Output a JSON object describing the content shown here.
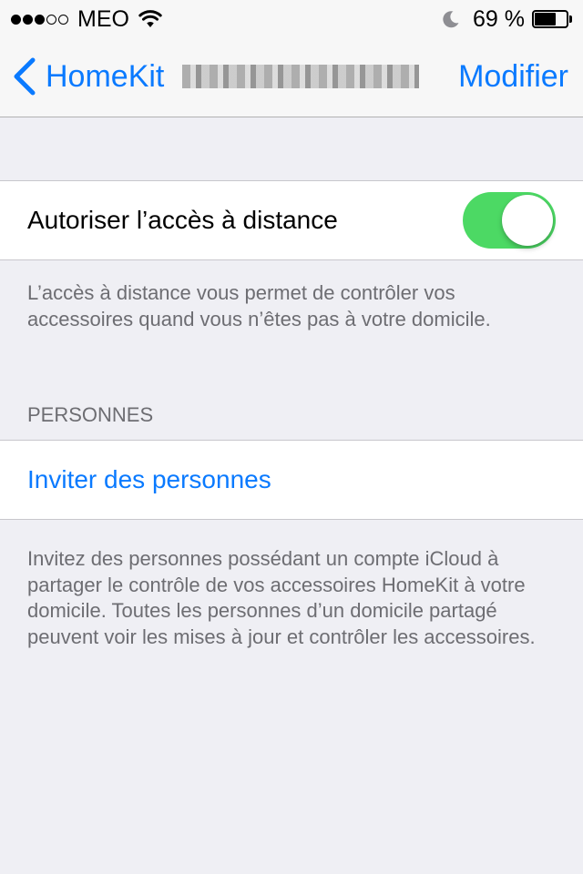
{
  "status_bar": {
    "carrier": "MEO",
    "signal_bars_filled": 3,
    "signal_bars_total": 5,
    "battery_percent": "69 %",
    "battery_level": 0.69,
    "icons": [
      "wifi-icon",
      "moon-icon",
      "battery-icon"
    ]
  },
  "nav": {
    "back_label": "HomeKit",
    "edit_label": "Modifier",
    "accent_color": "#0a7aff"
  },
  "remote_access": {
    "label": "Autoriser l’accès à distance",
    "enabled": true,
    "toggle_color": "#4cd964",
    "footer": "L’accès à distance vous permet de contrôler vos accessoires quand vous n’êtes pas à votre domicile."
  },
  "people": {
    "header": "PERSONNES",
    "invite_label": "Inviter des personnes",
    "footer": "Invitez des personnes possédant un compte iCloud à partager le contrôle de vos accessoires HomeKit à votre domicile. Toutes les personnes d’un domicile partagé peuvent voir les mises à jour et contrôler les accessoires."
  }
}
